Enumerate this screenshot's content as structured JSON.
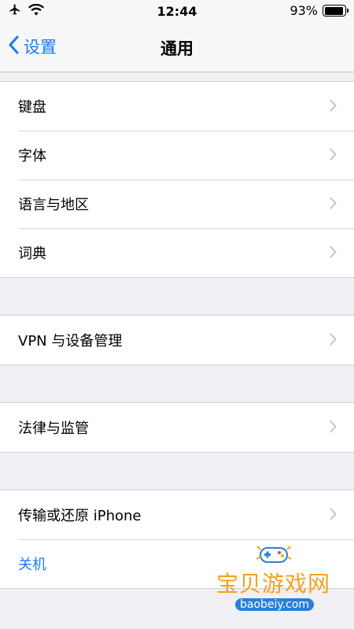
{
  "status_bar": {
    "time": "12:44",
    "battery_percent_label": "93%",
    "battery_level": 0.93,
    "icons": [
      "airplane-icon",
      "wifi-icon",
      "battery-icon"
    ]
  },
  "nav": {
    "back_label": "设置",
    "title": "通用"
  },
  "groups": [
    {
      "items": [
        {
          "label": "键盘"
        },
        {
          "label": "字体"
        },
        {
          "label": "语言与地区"
        },
        {
          "label": "词典"
        }
      ]
    },
    {
      "items": [
        {
          "label": "VPN 与设备管理"
        }
      ]
    },
    {
      "items": [
        {
          "label": "法律与监管"
        }
      ]
    },
    {
      "items": [
        {
          "label": "传输或还原 iPhone"
        },
        {
          "label": "关机"
        }
      ]
    }
  ],
  "watermark": {
    "text": "宝贝游戏网",
    "url": "baobeiy.com"
  },
  "colors": {
    "accent": "#1a7cf2",
    "background": "#efeff4",
    "watermark_orange": "#f4a11c"
  }
}
